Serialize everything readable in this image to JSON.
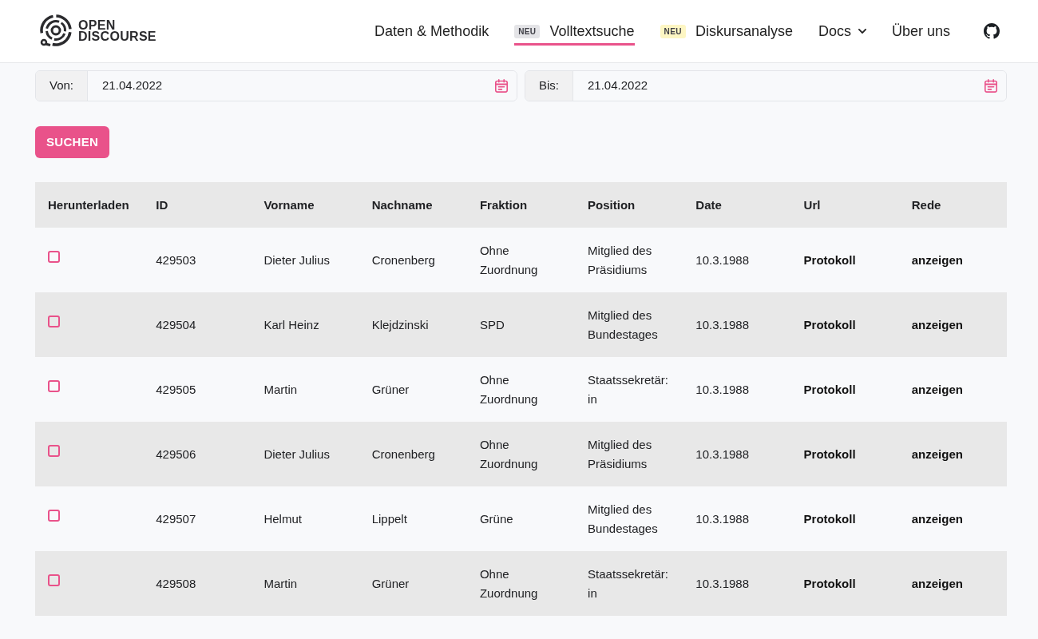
{
  "header": {
    "logo": {
      "lines": [
        "OPEN",
        "DISCOURSE"
      ]
    },
    "nav": [
      {
        "label": "Daten & Methodik",
        "selected": false,
        "dropdown": false
      },
      {
        "badge": {
          "text": "NEU",
          "color": "#e4e4e7"
        },
        "label": "Volltextsuche",
        "selected": true,
        "dropdown": false
      },
      {
        "badge": {
          "text": "NEU",
          "color": "#fdf6c3"
        },
        "label": "Diskursanalyse",
        "selected": false,
        "dropdown": false
      },
      {
        "label": "Docs",
        "selected": false,
        "dropdown": true
      },
      {
        "label": "Über uns",
        "selected": false,
        "dropdown": false
      }
    ]
  },
  "filters": [
    {
      "label": "Von:",
      "value": "21.04.2022"
    },
    {
      "label": "Bis:",
      "value": "21.04.2022"
    }
  ],
  "search_button": {
    "label": "SUCHEN"
  },
  "table": {
    "columns": [
      "Herunterladen",
      "ID",
      "Vorname",
      "Nachname",
      "Fraktion",
      "Position",
      "Date",
      "Url",
      "Rede"
    ],
    "rows": [
      {
        "checked": false,
        "id": "429503",
        "first_name": "Dieter Julius",
        "last_name": "Cronenberg",
        "faction": "Ohne Zuordnung",
        "position": "Mitglied des Präsidiums",
        "date": "10.3.1988",
        "url": "Protokoll",
        "speech": "anzeigen"
      },
      {
        "checked": false,
        "id": "429504",
        "first_name": "Karl Heinz",
        "last_name": "Klejdzinski",
        "faction": "SPD",
        "position": "Mitglied des Bundestages",
        "date": "10.3.1988",
        "url": "Protokoll",
        "speech": "anzeigen"
      },
      {
        "checked": false,
        "id": "429505",
        "first_name": "Martin",
        "last_name": "Grüner",
        "faction": "Ohne Zuordnung",
        "position": "Staatssekretär:in",
        "date": "10.3.1988",
        "url": "Protokoll",
        "speech": "anzeigen"
      },
      {
        "checked": false,
        "id": "429506",
        "first_name": "Dieter Julius",
        "last_name": "Cronenberg",
        "faction": "Ohne Zuordnung",
        "position": "Mitglied des Präsidiums",
        "date": "10.3.1988",
        "url": "Protokoll",
        "speech": "anzeigen"
      },
      {
        "checked": false,
        "id": "429507",
        "first_name": "Helmut",
        "last_name": "Lippelt",
        "faction": "Grüne",
        "position": "Mitglied des Bundestages",
        "date": "10.3.1988",
        "url": "Protokoll",
        "speech": "anzeigen"
      },
      {
        "checked": false,
        "id": "429508",
        "first_name": "Martin",
        "last_name": "Grüner",
        "faction": "Ohne Zuordnung",
        "position": "Staatssekretär:in",
        "date": "10.3.1988",
        "url": "Protokoll",
        "speech": "anzeigen"
      }
    ]
  }
}
